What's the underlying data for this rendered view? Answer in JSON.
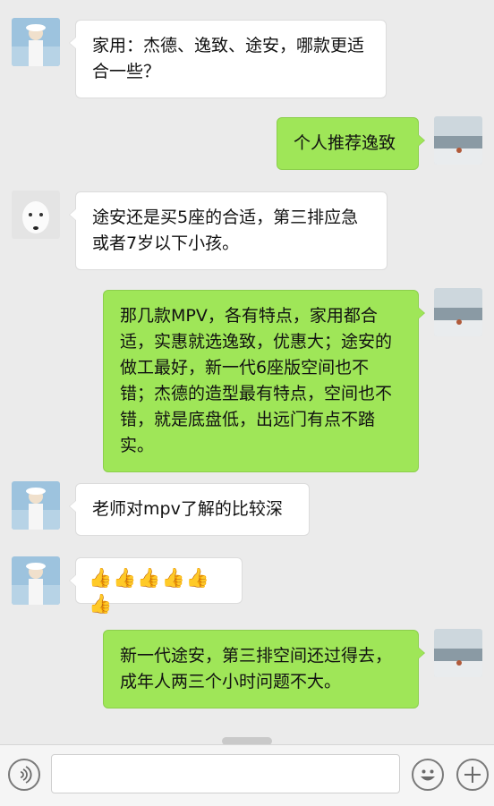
{
  "messages": [
    {
      "side": "left",
      "avatar": "person-avatar-icon",
      "text": "家用：杰德、逸致、途安，哪款更适合一些？"
    },
    {
      "side": "right",
      "avatar": "beach-photo-avatar",
      "text": "个人推荐逸致"
    },
    {
      "side": "left",
      "avatar": "white-wolf-avatar",
      "text": "途安还是买5座的合适，第三排应急或者7岁以下小孩。"
    },
    {
      "side": "right",
      "avatar": "beach-photo-avatar",
      "text": "那几款MPV，各有特点，家用都合适，实惠就选逸致，优惠大；途安的做工最好，新一代6座版空间也不错；杰德的造型最有特点，空间也不错，就是底盘低，出远门有点不踏实。"
    },
    {
      "side": "left",
      "avatar": "person-avatar-icon",
      "text": "老师对mpv了解的比较深"
    },
    {
      "side": "left",
      "avatar": "person-avatar-icon",
      "text": "👍👍👍👍👍👍"
    },
    {
      "side": "right",
      "avatar": "beach-photo-avatar",
      "text": "新一代途安，第三排空间还过得去，成年人两三个小时问题不大。"
    }
  ],
  "input_bar": {
    "voice_icon": "voice-icon",
    "emoji_icon": "emoji-icon",
    "plus_icon": "plus-icon",
    "input_value": ""
  },
  "colors": {
    "background": "#ebebeb",
    "sent_bubble": "#9fe658",
    "received_bubble": "#ffffff"
  }
}
